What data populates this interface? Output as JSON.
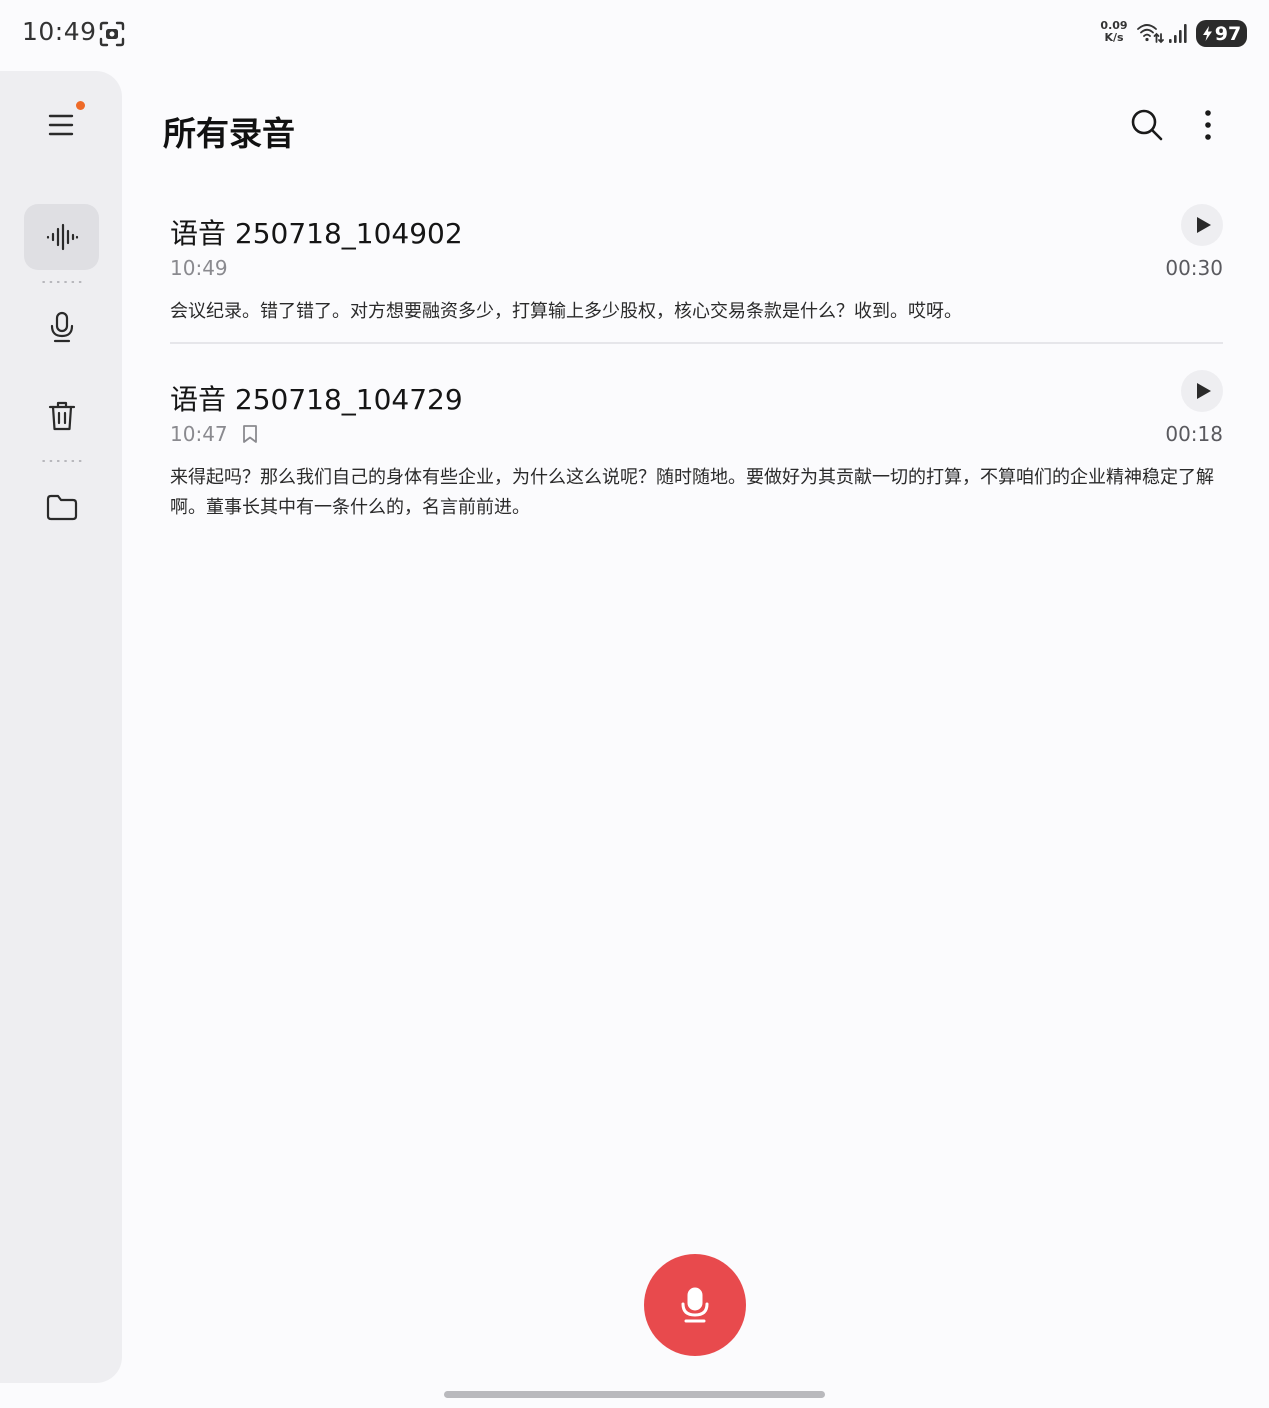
{
  "status_bar": {
    "time": "10:49",
    "net_speed_value": "0.09",
    "net_speed_unit": "K/s",
    "battery_level": "97",
    "screenshot_icon": "screenshot-icon",
    "wifi_icon": "wifi-icon",
    "signal_icon": "signal-icon"
  },
  "side_rail": {
    "items": [
      {
        "icon": "menu-icon",
        "has_notification_dot": true
      },
      {
        "icon": "waveform-icon",
        "active": true
      },
      {
        "icon": "microphone-icon"
      },
      {
        "icon": "trash-icon"
      },
      {
        "icon": "folder-icon"
      }
    ]
  },
  "header": {
    "title": "所有录音",
    "search_icon": "search-icon",
    "more_icon": "more-vert-icon"
  },
  "recordings": [
    {
      "title": "语音 250718_104902",
      "time": "10:49",
      "duration": "00:30",
      "bookmarked": false,
      "transcript": "会议纪录。错了错了。对方想要融资多少，打算输上多少股权，核心交易条款是什么？收到。哎呀。"
    },
    {
      "title": "语音 250718_104729",
      "time": "10:47",
      "duration": "00:18",
      "bookmarked": true,
      "transcript": "来得起吗？那么我们自己的身体有些企业，为什么这么说呢？随时随地。要做好为其贡献一切的打算，不算咱们的企业精神稳定了解啊。董事长其中有一条什么的，名言前前进。"
    }
  ],
  "colors": {
    "accent": "#e84a4d",
    "notification_dot": "#ee6a28",
    "rail_background": "#eeeef1",
    "page_background": "#fbfbfd"
  }
}
